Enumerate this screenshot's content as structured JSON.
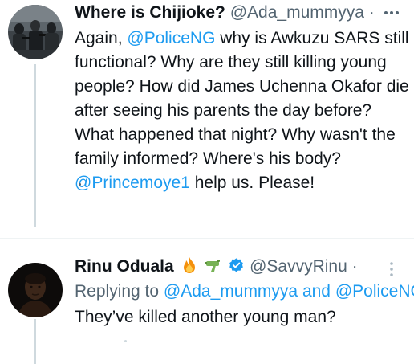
{
  "tweets": [
    {
      "display_name": "Where is Chijioke?",
      "handle": "@Ada_mummyya",
      "separator": "·",
      "body": {
        "t1": "Again, ",
        "mention_police": "@PoliceNG",
        "t2": " why is Awkuzu SARS still functional? Why are they still killing young people? How did James Uchenna Okafor die after seeing his parents the day before? What happened that night? Why wasn't the family informed? Where's his body? ",
        "mention_prince": "@Princemoye1",
        "t3": " help us. Please!"
      },
      "avatar_icon": "protest-photo-avatar",
      "more_icon": "more-options-icon"
    },
    {
      "display_name": "Rinu Oduala",
      "handle": "@SavvyRinu",
      "separator": "·",
      "name_emojis": [
        "fire-emoji",
        "water-pistol-emoji"
      ],
      "verified_icon": "verified-badge-icon",
      "reply_prefix": "Replying to ",
      "reply_to_1": "@Ada_mummyya",
      "reply_and": " and ",
      "reply_to_2": "@PoliceNG",
      "body": "They’ve killed another young man?",
      "avatar_icon": "profile-photo-avatar",
      "more_icon": "more-options-icon"
    }
  ],
  "colors": {
    "text_primary": "#0f1419",
    "text_secondary": "#536471",
    "link": "#1d9bf0",
    "thread_line": "#cfd9de",
    "divider": "#eff3f4"
  }
}
